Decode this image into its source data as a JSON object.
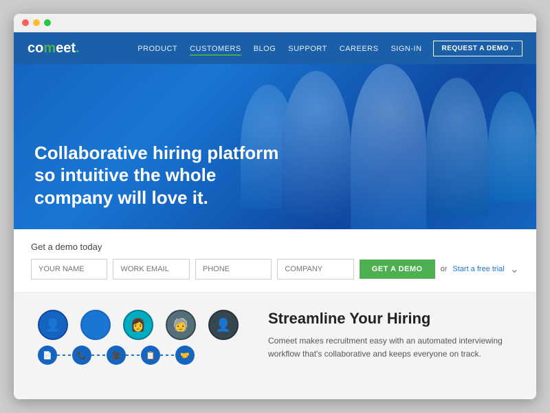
{
  "browser": {
    "dots": [
      "red",
      "yellow",
      "green"
    ]
  },
  "navbar": {
    "logo": "comeet.",
    "nav_items": [
      {
        "label": "PRODUCT",
        "active": false
      },
      {
        "label": "CUSTOMERS",
        "active": true
      },
      {
        "label": "BLOG",
        "active": false
      },
      {
        "label": "SUPPORT",
        "active": false
      },
      {
        "label": "CAREERS",
        "active": false
      },
      {
        "label": "SIGN-IN",
        "active": false
      }
    ],
    "cta_label": "REQUEST A DEMO ›"
  },
  "hero": {
    "headline": "Collaborative hiring platform so intuitive the whole company will love it."
  },
  "demo_section": {
    "label": "Get a demo today",
    "fields": [
      {
        "placeholder": "YOUR NAME"
      },
      {
        "placeholder": "WORK EMAIL"
      },
      {
        "placeholder": "PHONE"
      },
      {
        "placeholder": "COMPANY"
      }
    ],
    "cta_label": "GET A DEMO",
    "or_text": "or",
    "free_trial_label": "Start a free trial"
  },
  "streamline": {
    "heading": "Streamline Your Hiring",
    "body": "Comeet makes recruitment easy with an automated interviewing workflow that's collaborative and keeps everyone on track.",
    "steps": [
      {
        "icon": "📄"
      },
      {
        "icon": "📞"
      },
      {
        "icon": "🎥"
      },
      {
        "icon": "📋"
      },
      {
        "icon": "🤝"
      }
    ]
  }
}
